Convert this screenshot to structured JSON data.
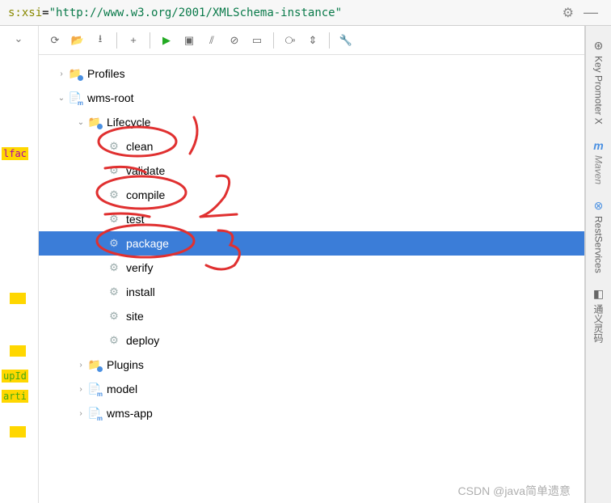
{
  "topbar": {
    "url_attr": "s:xsi",
    "url_eq": "=",
    "url_val": "\"http://www.w3.org/2001/XMLSchema-instance\""
  },
  "toolbar": {
    "refresh": "⟳",
    "add_folder": "📁",
    "download": "⭳",
    "plus": "+",
    "run": "▶",
    "step": "⧉",
    "skip": "⇥",
    "stop": "⊘",
    "pause": "▭",
    "graph": "⧂",
    "collapse": "⇵",
    "wrench": "🔧"
  },
  "tree": {
    "profiles": "Profiles",
    "root": "wms-root",
    "lifecycle": "Lifecycle",
    "goals": [
      "clean",
      "validate",
      "compile",
      "test",
      "package",
      "verify",
      "install",
      "site",
      "deploy"
    ],
    "plugins": "Plugins",
    "model": "model",
    "wmsapp": "wms-app"
  },
  "selected_goal": "package",
  "gutter": {
    "t1": "lfac",
    "t2": "upId",
    "t3": "arti"
  },
  "sidebar": {
    "tabs": [
      "Key Promoter X",
      "Maven",
      "RestServices",
      "通义灵码"
    ]
  },
  "watermark": "CSDN @java简单遗意"
}
